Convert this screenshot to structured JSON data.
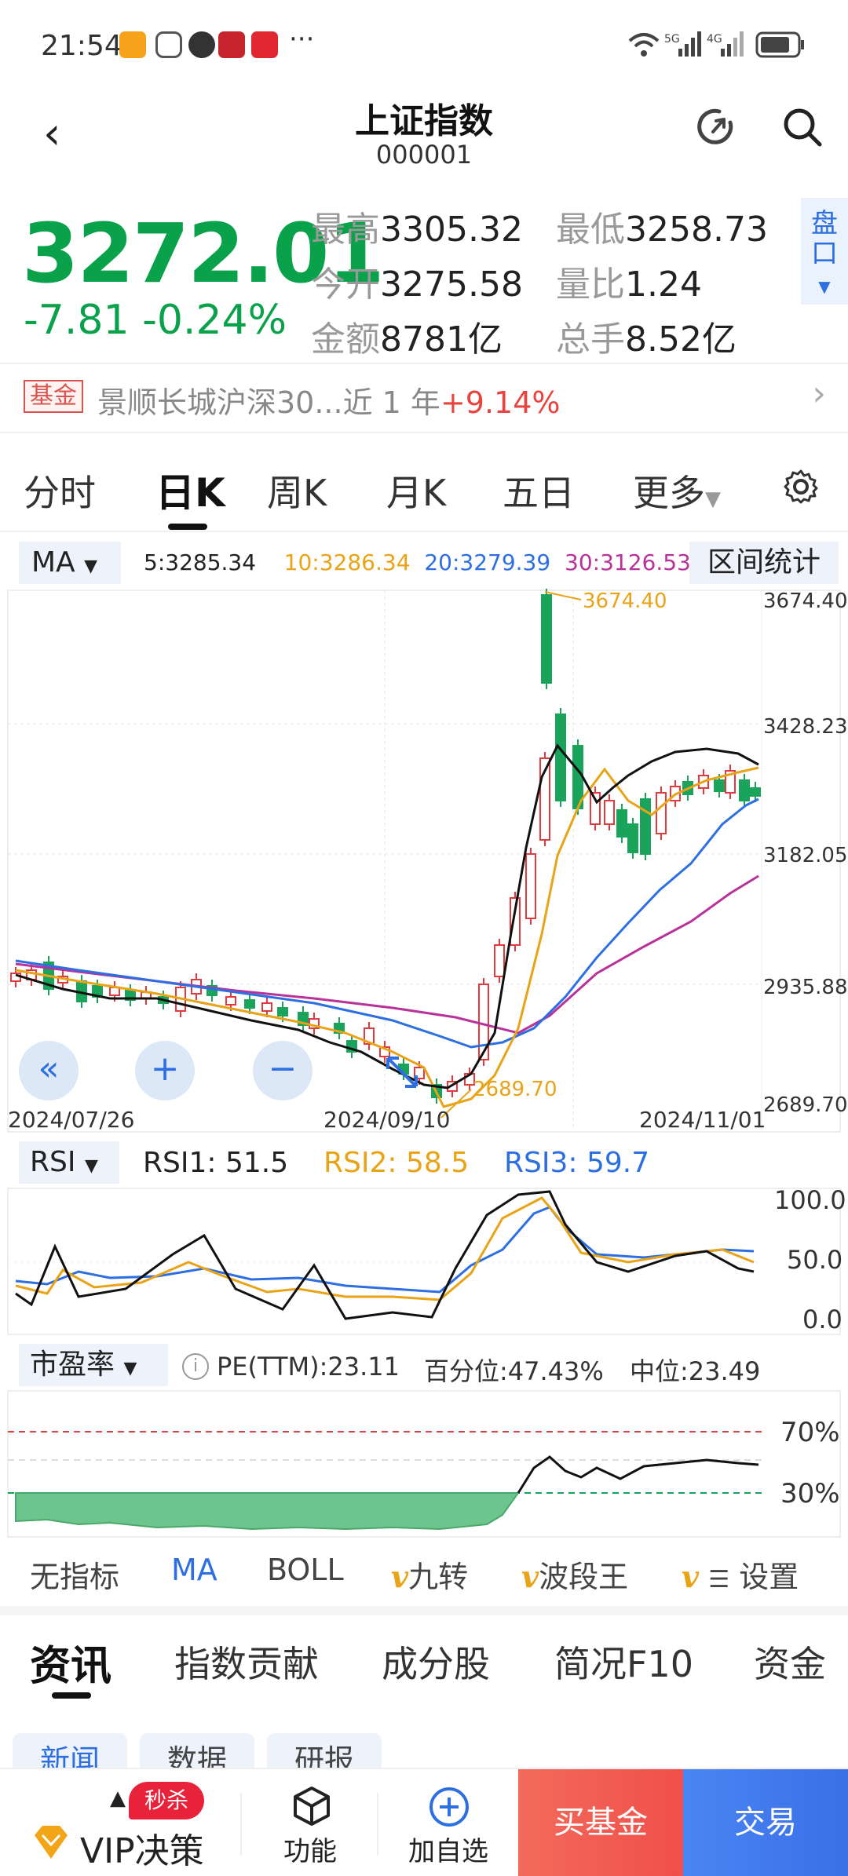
{
  "status": {
    "time": "21:54",
    "battery_icon": "battery-icon",
    "net1": "5G",
    "net2": "4G"
  },
  "header": {
    "title": "上证指数",
    "code": "000001"
  },
  "quote": {
    "price": "3272.01",
    "change": "-7.81",
    "change_pct": "-0.24%",
    "high_label": "最高",
    "high": "3305.32",
    "low_label": "最低",
    "low": "3258.73",
    "open_label": "今开",
    "open": "3275.58",
    "ratio_label": "量比",
    "ratio": "1.24",
    "amount_label": "金额",
    "amount": "8781亿",
    "hands_label": "总手",
    "hands": "8.52亿",
    "pankou": "盘口",
    "colors": {
      "down": "#0aa14b",
      "up": "#e8433e"
    }
  },
  "fund": {
    "tag": "基金",
    "name": "景顺长城沪深30...近 1 年",
    "ret": "+9.14%"
  },
  "tabs": [
    "分时",
    "日K",
    "周K",
    "月K",
    "五日",
    "更多"
  ],
  "ma": {
    "selector": "MA",
    "ma5": "5:3285.34",
    "ma10": "10:3286.34",
    "ma20": "20:3279.39",
    "ma30": "30:3126.53",
    "range_stat": "区间统计"
  },
  "kline": {
    "y_ticks": [
      "3674.40",
      "3428.23",
      "3182.05",
      "2935.88",
      "2689.70"
    ],
    "dates": [
      "2024/07/26",
      "2024/09/10",
      "2024/11/01"
    ],
    "high_mark": "3674.40",
    "low_mark": "2689.70"
  },
  "rsi": {
    "selector": "RSI",
    "rsi1": "RSI1: 51.5",
    "rsi2": "RSI2: 58.5",
    "rsi3": "RSI3: 59.7",
    "ticks": [
      "100.0",
      "50.0",
      "0.0"
    ]
  },
  "pe": {
    "selector": "市盈率",
    "ttm": "PE(TTM):23.11",
    "pct": "百分位:47.43%",
    "median": "中位:23.49",
    "ticks": [
      "70%",
      "30%"
    ]
  },
  "indicators": [
    "无指标",
    "MA",
    "BOLL",
    "九转",
    "波段王",
    "设置"
  ],
  "sections": [
    "资讯",
    "指数贡献",
    "成分股",
    "简况F10",
    "资金"
  ],
  "news_tabs": [
    "新闻",
    "数据",
    "研报"
  ],
  "bottom": {
    "vip": "VIP决策",
    "miaosha": "秒杀",
    "func": "功能",
    "add": "加自选",
    "buy_fund": "买基金",
    "trade": "交易"
  }
}
